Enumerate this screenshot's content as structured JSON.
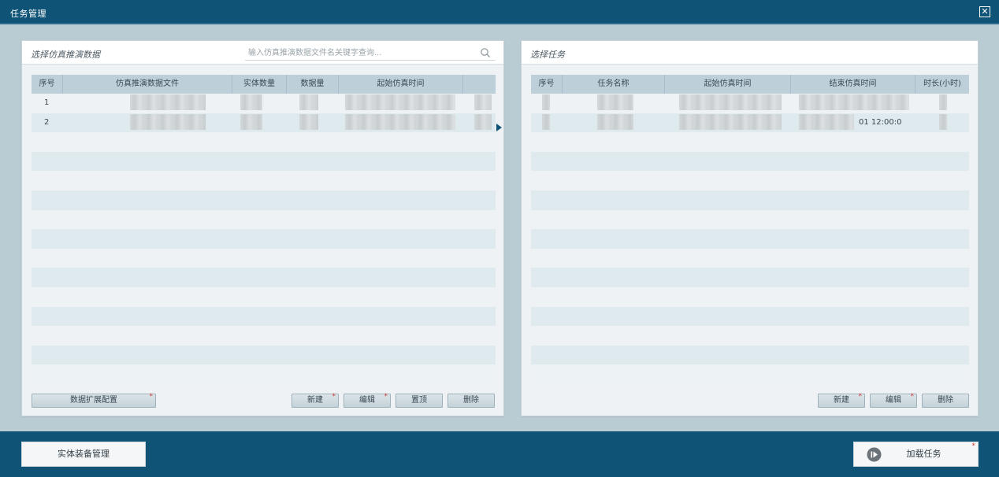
{
  "window": {
    "title": "任务管理",
    "close_label": "✕"
  },
  "left_panel": {
    "title": "选择仿真推演数据",
    "search_placeholder": "输入仿真推演数据文件名关键字查询...",
    "columns": [
      "序号",
      "仿真推演数据文件",
      "实体数量",
      "数据量",
      "起始仿真时间"
    ],
    "rows": [
      {
        "index": "1"
      },
      {
        "index": "2"
      }
    ],
    "buttons": {
      "expand_config": "数据扩展配置",
      "new": "新建",
      "edit": "编辑",
      "top": "置顶",
      "delete": "删除"
    }
  },
  "right_panel": {
    "title": "选择任务",
    "columns": [
      "序号",
      "任务名称",
      "起始仿真时间",
      "结束仿真时间",
      "时长(小时)"
    ],
    "row_fragment": "01 12:00:0",
    "buttons": {
      "new": "新建",
      "edit": "编辑",
      "delete": "删除"
    }
  },
  "footer": {
    "entity_equipment_mgmt": "实体装备管理",
    "load_task": "加载任务"
  },
  "colors": {
    "titlebar": "#0f5476",
    "workspace": "#b9cbd3",
    "table_header": "#bdd0d9",
    "required_marker": "#d23b3b"
  }
}
